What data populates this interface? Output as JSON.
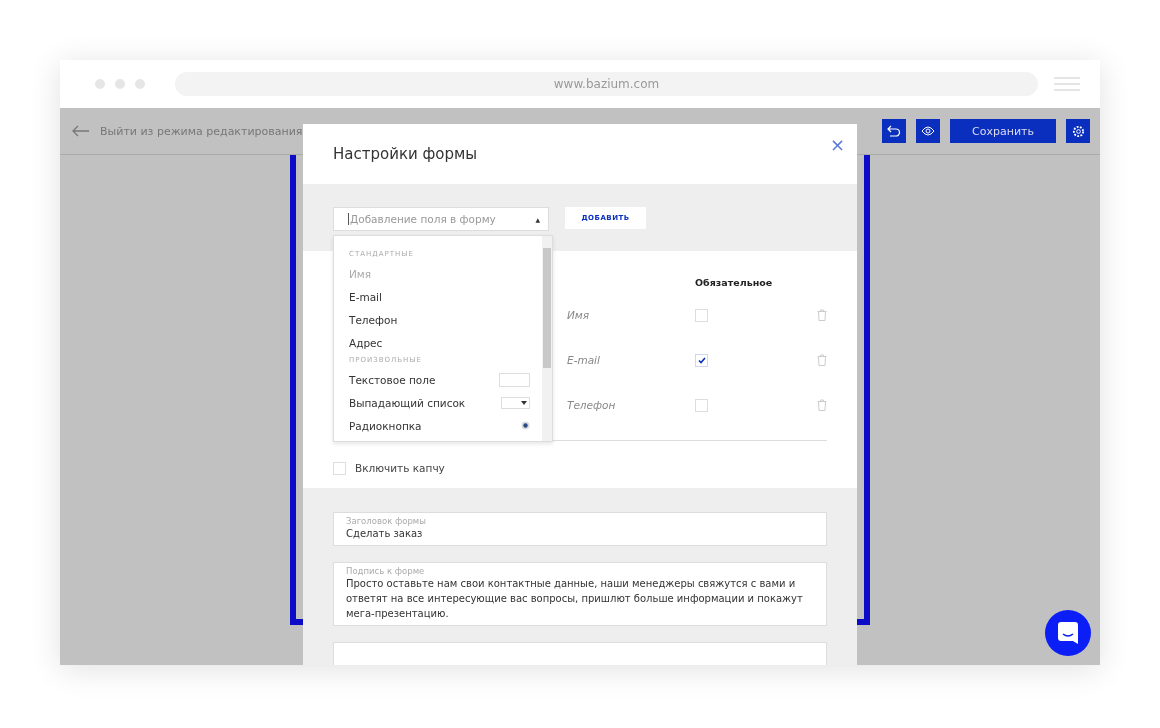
{
  "browser": {
    "url": "www.bazium.com"
  },
  "toolbar": {
    "exit_label": "Выйти из режима редактирования",
    "save_label": "Сохранить"
  },
  "modal": {
    "title": "Настройки формы",
    "close": "×",
    "add_field": {
      "placeholder": "Добавление поля в форму",
      "caret": "▲",
      "button": "ДОБАВИТЬ",
      "expanded": true
    },
    "dropdown_items": [
      {
        "kind": "group",
        "label": "СТАНДАРТНЫЕ"
      },
      {
        "kind": "option",
        "label": "Имя",
        "disabled": true
      },
      {
        "kind": "option",
        "label": "E-mail",
        "disabled": false
      },
      {
        "kind": "option",
        "label": "Телефон",
        "disabled": false
      },
      {
        "kind": "option",
        "label": "Адрес",
        "disabled": false
      },
      {
        "kind": "group",
        "label": "ПРОИЗВОЛЬНЫЕ"
      },
      {
        "kind": "text",
        "label": "Текстовое поле",
        "disabled": false
      },
      {
        "kind": "select",
        "label": "Выпадающий список",
        "disabled": false
      },
      {
        "kind": "radio",
        "label": "Радиокнопка",
        "disabled": false
      }
    ],
    "table": {
      "columns": [
        "Обязательное"
      ],
      "rows": [
        {
          "name": "Имя",
          "required": false
        },
        {
          "name": "E-mail",
          "required": true
        },
        {
          "name": "Телефон",
          "required": false
        }
      ]
    },
    "captcha": {
      "label": "Включить капчу",
      "checked": false
    },
    "fields": [
      {
        "label": "Заголовок формы",
        "value": "Сделать заказ"
      },
      {
        "label": "Подпись к форме",
        "value": "Просто оставьте нам свои контактные данные, наши менеджеры свяжутся с вами и ответят на все интересующие вас вопросы, пришлют больше информации и покажут мега-презентацию."
      }
    ]
  }
}
